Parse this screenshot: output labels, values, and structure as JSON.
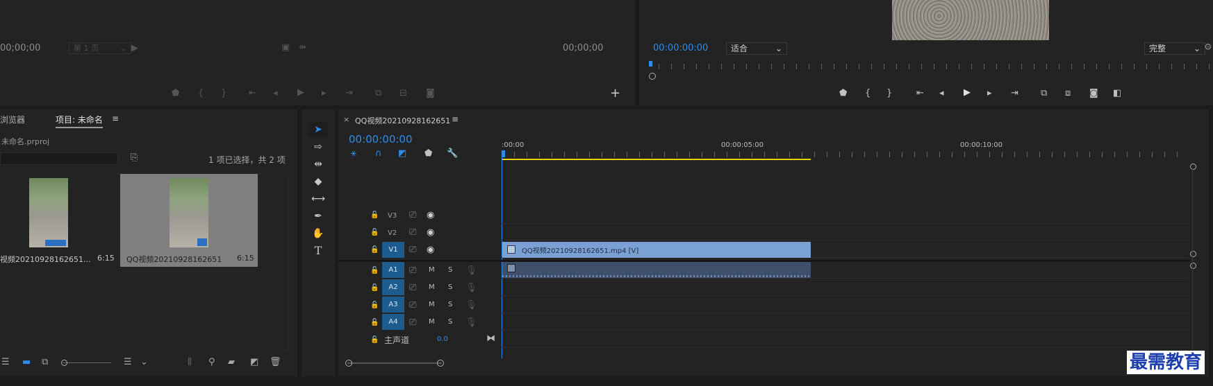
{
  "source_monitor": {
    "timecode_left": "00;00;00",
    "page_select": "第 1 页",
    "timecode_right": "00;00;00",
    "add_button": "+"
  },
  "program_monitor": {
    "timecode": "00:00:00:00",
    "zoom_select": "适合",
    "quality_select": "完整"
  },
  "project_panel": {
    "tab_media_browser": "浏览器",
    "tab_project": "项目: 未命名",
    "tab_menu": "≡",
    "project_file": "未命名.prproj",
    "search_placeholder": "",
    "selection_status": "1 项已选择，共 2 项",
    "items": [
      {
        "name": "视频20210928162651...",
        "duration": "6:15"
      },
      {
        "name": "QQ视频20210928162651",
        "duration": "6:15"
      }
    ]
  },
  "timeline": {
    "close": "×",
    "sequence_tab": "QQ视频20210928162651",
    "tab_menu": "≡",
    "timecode": "00:00:00:00",
    "ruler_labels": [
      ":00:00",
      "00:00:05:00",
      "00:00:10:00"
    ],
    "video_tracks": [
      {
        "name": "V3",
        "target": ""
      },
      {
        "name": "V2",
        "target": ""
      },
      {
        "name": "V1",
        "target": "V1"
      }
    ],
    "audio_tracks": [
      {
        "target": "A1",
        "name": "A1",
        "m": "M",
        "s": "S"
      },
      {
        "target": "A2",
        "name": "A2",
        "m": "M",
        "s": "S"
      },
      {
        "target": "A3",
        "name": "A3",
        "m": "M",
        "s": "S"
      },
      {
        "target": "A4",
        "name": "A4",
        "m": "M",
        "s": "S"
      }
    ],
    "master_label": "主声道",
    "master_value": "0.0",
    "video_clip_label": "QQ视频20210928162651.mp4 [V]"
  },
  "watermark": "最需教育",
  "colors": {
    "accent": "#2d8ceb",
    "video_clip": "#7aa0d4",
    "audio_clip": "#3d4f6b",
    "work_area": "#e6d200",
    "track_target": "#1d5c8f"
  }
}
